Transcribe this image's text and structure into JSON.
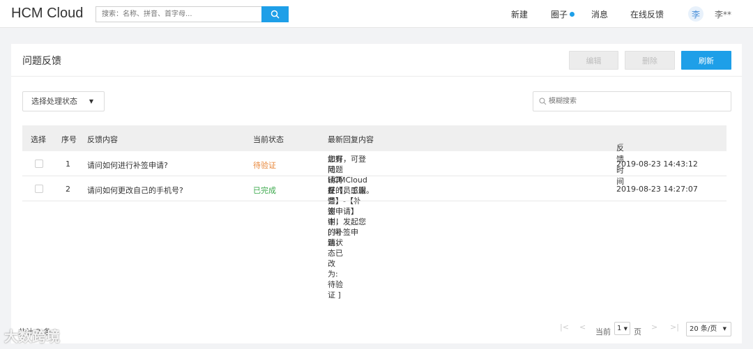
{
  "app": {
    "brand": "HCM Cloud"
  },
  "search": {
    "placeholder": "搜索：名称、拼音、首字母..."
  },
  "nav": {
    "new": "新建",
    "circle": "圈子",
    "messages": "消息",
    "feedback": "在线反馈"
  },
  "user": {
    "avatar_char": "李",
    "name": "李**"
  },
  "page": {
    "title": "问题反馈"
  },
  "toolbar": {
    "edit_label": "编辑",
    "delete_label": "删除",
    "refresh_label": "刷新"
  },
  "filter": {
    "status_placeholder": "选择处理状态",
    "fuzzy_placeholder": "模糊搜索"
  },
  "table": {
    "headers": [
      "选择",
      "序号",
      "反馈内容",
      "当前状态",
      "最新回复内容",
      "反馈时间"
    ],
    "rows": [
      {
        "no": "1",
        "content": "请问如何进行补签申请?",
        "status": "待验证",
        "reply_line1": "您好，可登陆HCMCloud在【员工服务】-【补签申请】中，发起您的补签申请，",
        "reply_line2": "如有问题请再反馈，谢谢！[ 问题状态已改为:待验证 ]",
        "time": "2019-08-23 14:43:12"
      },
      {
        "no": "2",
        "content": "请问如何更改自己的手机号?",
        "status": "已完成",
        "reply_line1": "好的，感谢。",
        "time": "2019-08-23 14:27:07"
      }
    ]
  },
  "footer": {
    "total": "共计 2 条",
    "current_label": "当前",
    "page_value": "1",
    "page_unit": "页",
    "page_size": "20 条/页"
  },
  "watermark": {
    "text": "大数跨境"
  },
  "colors": {
    "accent": "#1e9fe8",
    "pending": "#e8873a",
    "done": "#3aa84a"
  }
}
